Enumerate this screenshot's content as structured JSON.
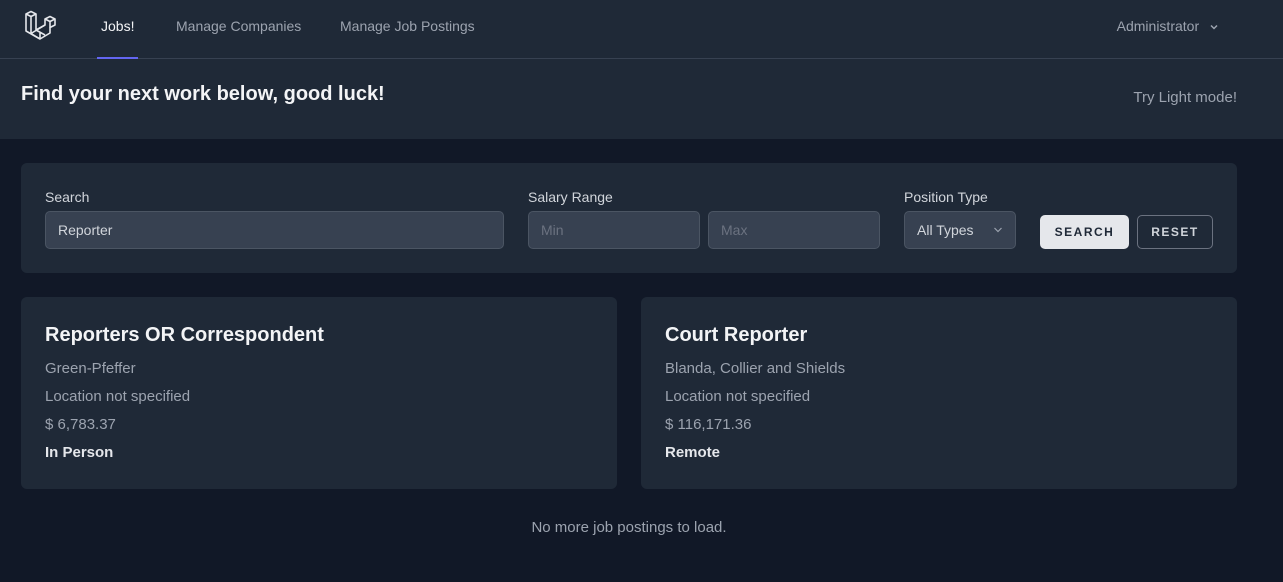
{
  "nav": {
    "logo_icon": "laravel-logo-icon",
    "links": [
      {
        "label": "Jobs!",
        "active": true
      },
      {
        "label": "Manage Companies",
        "active": false
      },
      {
        "label": "Manage Job Postings",
        "active": false
      }
    ],
    "user_menu": {
      "label": "Administrator",
      "icon": "chevron-down-icon"
    }
  },
  "header": {
    "title": "Find your next work below, good luck!",
    "theme_toggle": "Try Light mode!"
  },
  "filters": {
    "search": {
      "label": "Search",
      "value": "Reporter"
    },
    "salary": {
      "label": "Salary Range",
      "min_placeholder": "Min",
      "max_placeholder": "Max"
    },
    "position_type": {
      "label": "Position Type",
      "selected": "All Types"
    },
    "search_button": "SEARCH",
    "reset_button": "RESET"
  },
  "jobs": [
    {
      "title": "Reporters OR Correspondent",
      "company": "Green-Pfeffer",
      "location": "Location not specified",
      "salary": "$ 6,783.37",
      "type": "In Person"
    },
    {
      "title": "Court Reporter",
      "company": "Blanda, Collier and Shields",
      "location": "Location not specified",
      "salary": "$ 116,171.36",
      "type": "Remote"
    }
  ],
  "footer_note": "No more job postings to load.",
  "colors": {
    "background": "#111827",
    "surface": "#1f2937",
    "accent": "#6366f1"
  }
}
